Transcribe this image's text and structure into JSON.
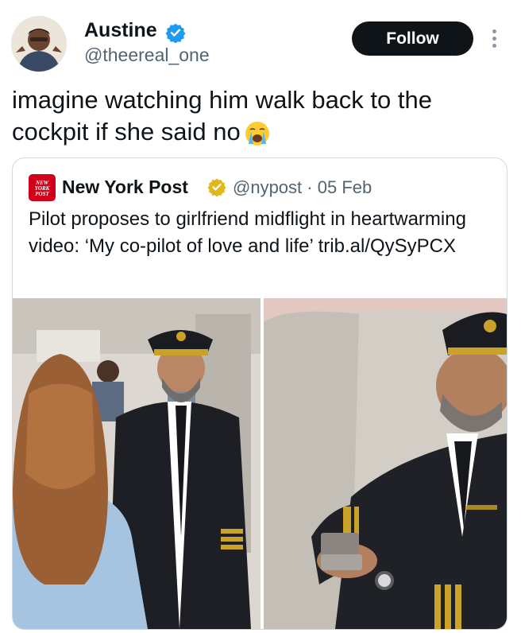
{
  "author": {
    "name": "Austine",
    "handle": "@theereal_one",
    "verified_icon": "verified-badge-icon",
    "accent": "#1d9bf0"
  },
  "follow_button": {
    "label": "Follow"
  },
  "more_menu_icon": "more-options-icon",
  "tweet": {
    "text": "imagine watching him walk back to the cockpit if she said no",
    "emoji": "loudly-crying-face-emoji"
  },
  "quoted": {
    "source_name": "New York Post",
    "logo_text": "NEW YORK POST",
    "badge_icon": "gold-verified-badge-icon",
    "handle": "@nypost",
    "date": "05 Feb",
    "separator": "·",
    "text": "Pilot proposes to girlfriend midflight in heartwarming video: ‘My co-pilot of love and life’ trib.al/QySyPCX",
    "media": [
      {
        "name": "pilot-facing-girlfriend-in-aisle-photo"
      },
      {
        "name": "pilot-holding-open-ring-box-photo"
      }
    ]
  }
}
